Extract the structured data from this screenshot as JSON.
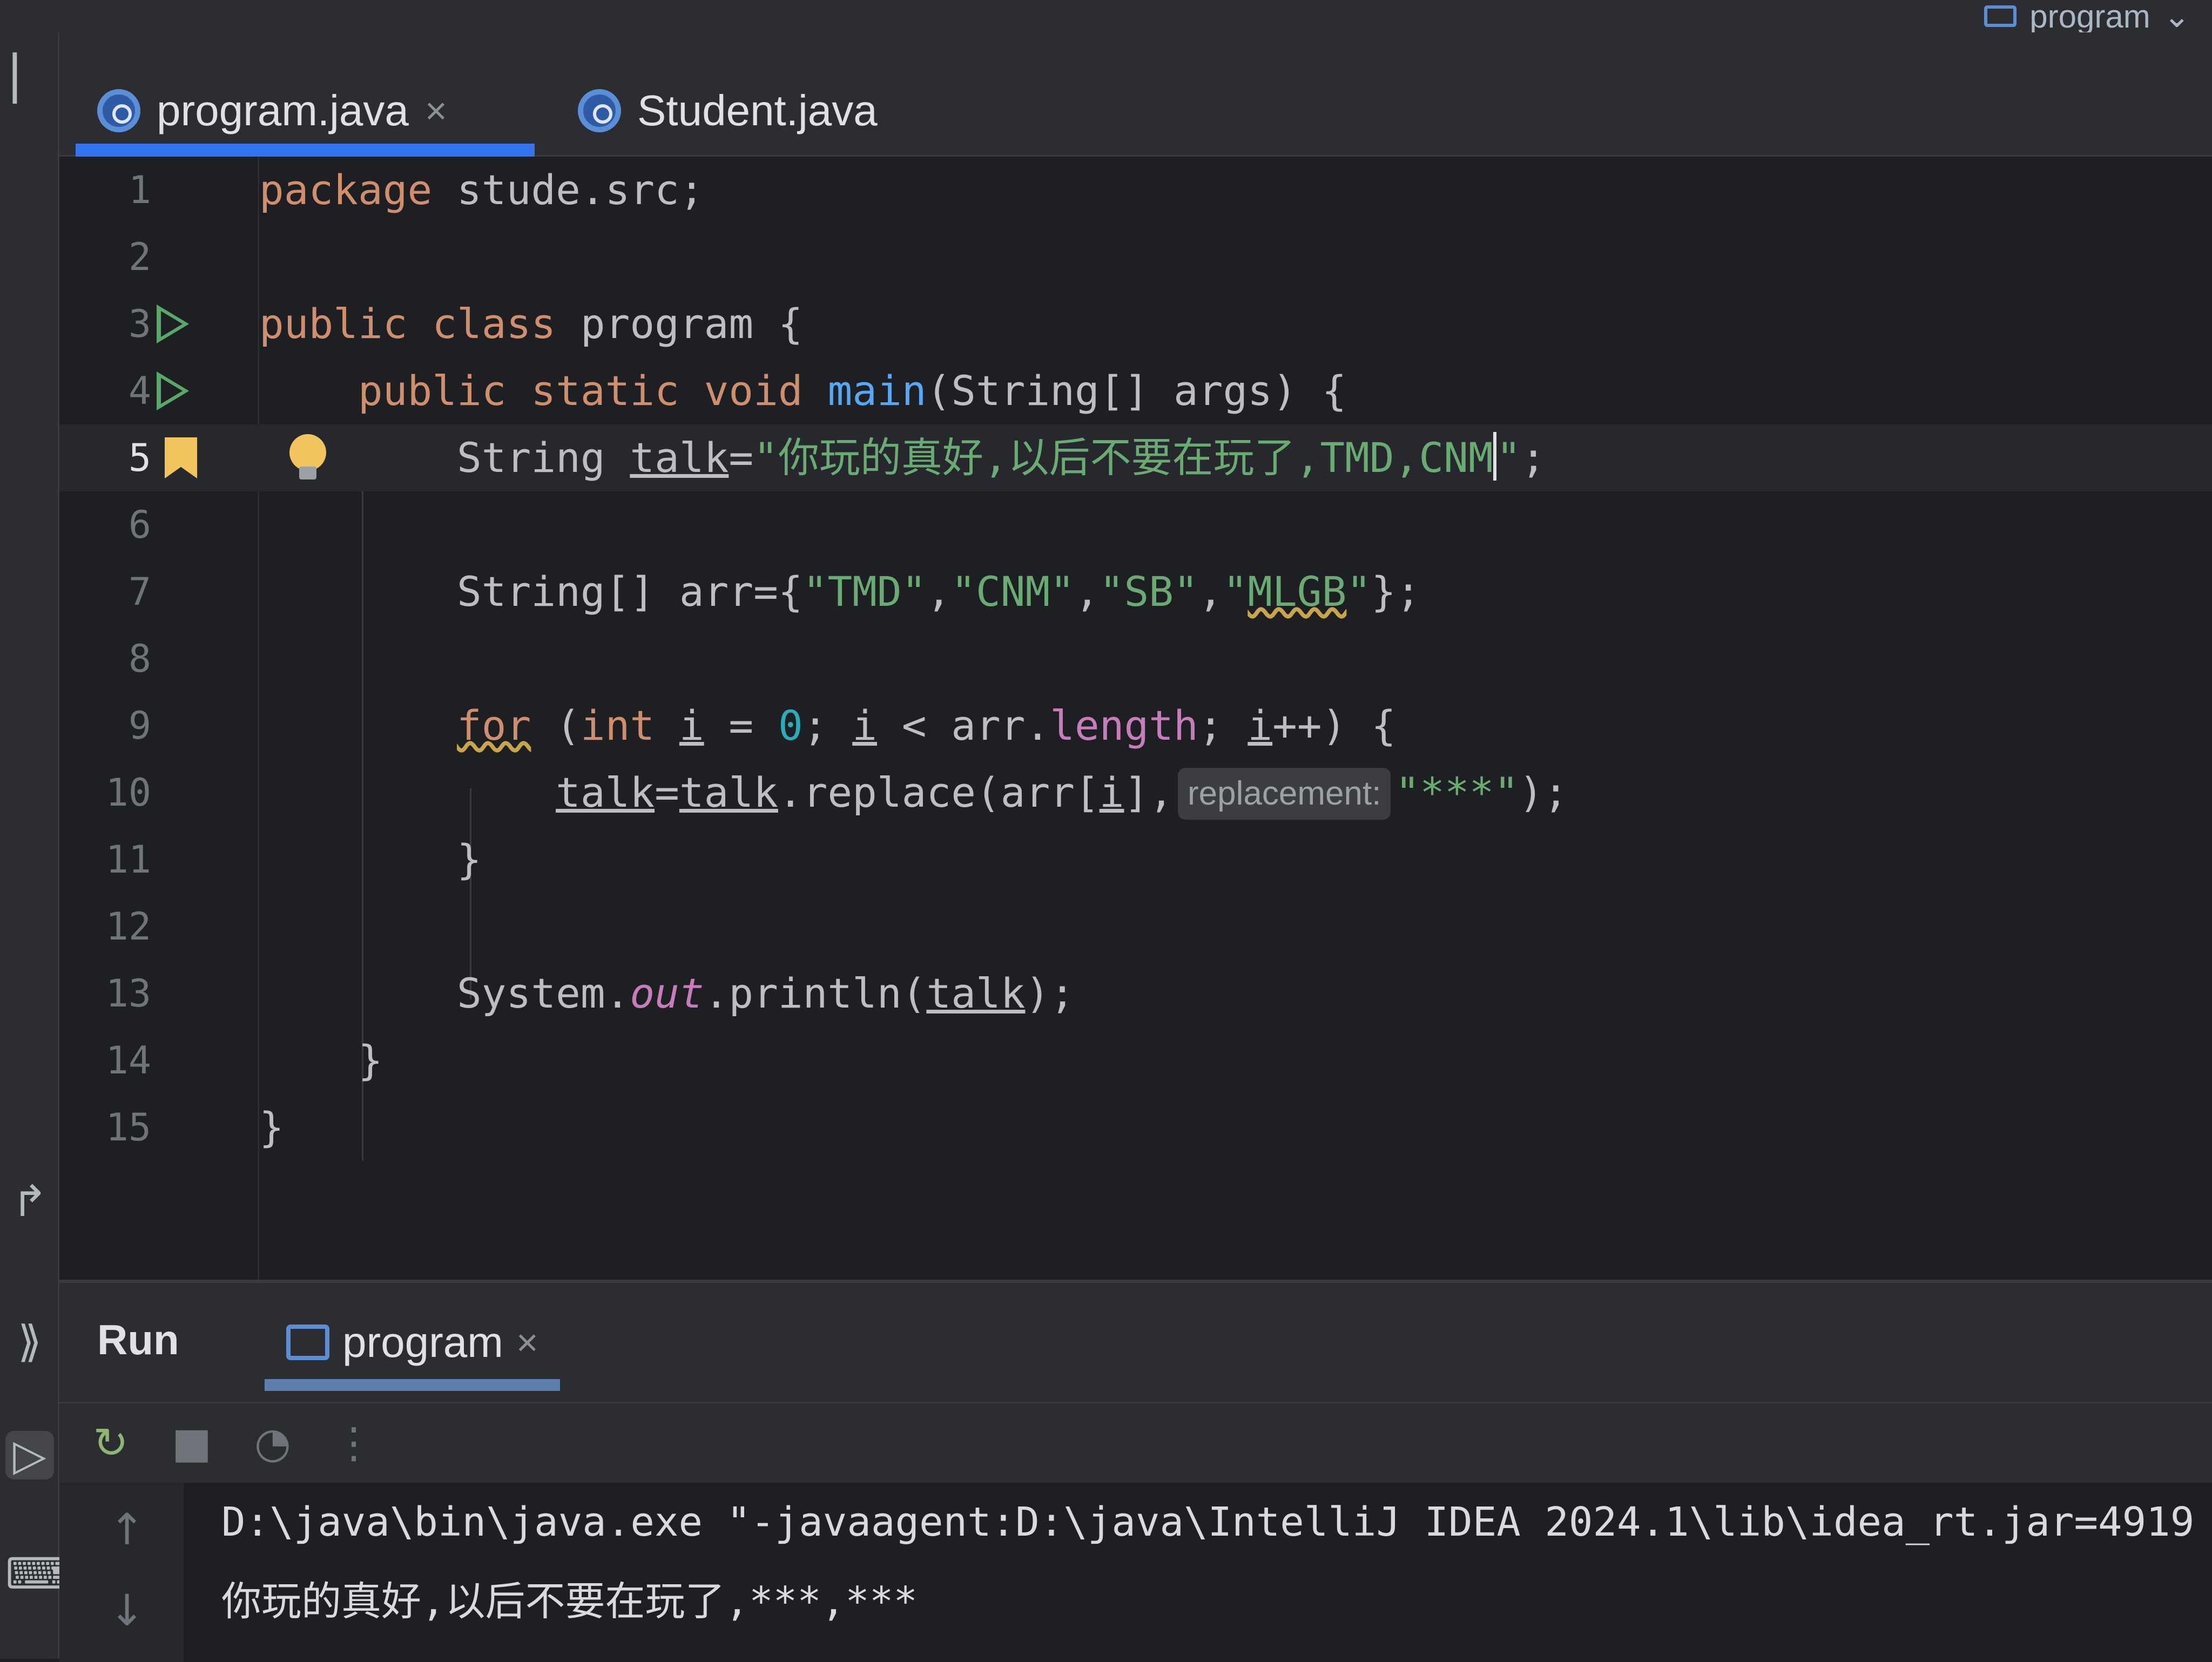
{
  "run_config": {
    "label": "program"
  },
  "tabs": [
    {
      "label": "program.java",
      "close": "×",
      "active": true
    },
    {
      "label": "Student.java",
      "active": false
    }
  ],
  "editor": {
    "line_numbers": [
      "1",
      "2",
      "3",
      "4",
      "5",
      "6",
      "7",
      "8",
      "9",
      "10",
      "11",
      "12",
      "13",
      "14",
      "15"
    ],
    "current_line": 5,
    "lines": {
      "l1": {
        "kw": "package",
        "rest": " stude.src;"
      },
      "l3": {
        "kw1": "public",
        "kw2": "class",
        "rest": " program {"
      },
      "l4": {
        "kw1": "public",
        "kw2": "static",
        "kw3": "void",
        "fn": "main",
        "rest": "(String[] args) {"
      },
      "l5": {
        "type": "String ",
        "var": "talk",
        "eq": "=",
        "str": "\"你玩的真好,以后不要在玩了,TMD,CNM",
        "str_end": "\"",
        "semi": ";"
      },
      "l7": {
        "pre": "String[] arr={",
        "s1": "\"TMD\"",
        "c1": ",",
        "s2": "\"CNM\"",
        "c2": ",",
        "s3": "\"SB\"",
        "c3": ",",
        "s4a": "\"",
        "s4b": "MLGB",
        "s4c": "\"",
        "end": "};"
      },
      "l9": {
        "kw": "for",
        "open": " (",
        "kw_int": "int",
        "sp": " ",
        "v1": "i",
        "eq": " = ",
        "zero": "0",
        "mid": "; ",
        "v2": "i",
        "lt": " < arr.",
        "len": "length",
        "semi": "; ",
        "v3": "i",
        "end": "++) {"
      },
      "l10": {
        "v1": "talk",
        "eq": "=",
        "v2": "talk",
        "call": ".replace(arr[",
        "v3": "i",
        "close": "],",
        "hint": "replacement:",
        "str": "\"***\"",
        "end": ");"
      },
      "l11": {
        "text": "}"
      },
      "l13": {
        "cls": "System.",
        "field": "out",
        "call": ".println(",
        "var": "talk",
        "end": ");"
      },
      "l14": {
        "text": "}"
      },
      "l15": {
        "text": "}"
      }
    }
  },
  "run_panel": {
    "title": "Run",
    "tab_label": "program",
    "tab_close": "×",
    "console_lines": [
      "D:\\java\\bin\\java.exe \"-javaagent:D:\\java\\IntelliJ IDEA 2024.1\\lib\\idea_rt.jar=4919",
      "你玩的真好,以后不要在玩了,***,***"
    ]
  },
  "icons": {
    "tab_class": "class-icon",
    "run_gutter": "run-arrow-icon",
    "bookmark": "bookmark-icon",
    "intention": "lightbulb-icon",
    "rerun": "rerun-icon",
    "stop": "stop-icon",
    "profiler": "gauge-icon",
    "more": "more-vertical-icon"
  },
  "colors": {
    "keyword": "#cf8e6d",
    "string": "#6aab73",
    "number": "#2aacb8",
    "function": "#56a8f5",
    "field": "#c77dbb",
    "accent": "#3574f0"
  }
}
